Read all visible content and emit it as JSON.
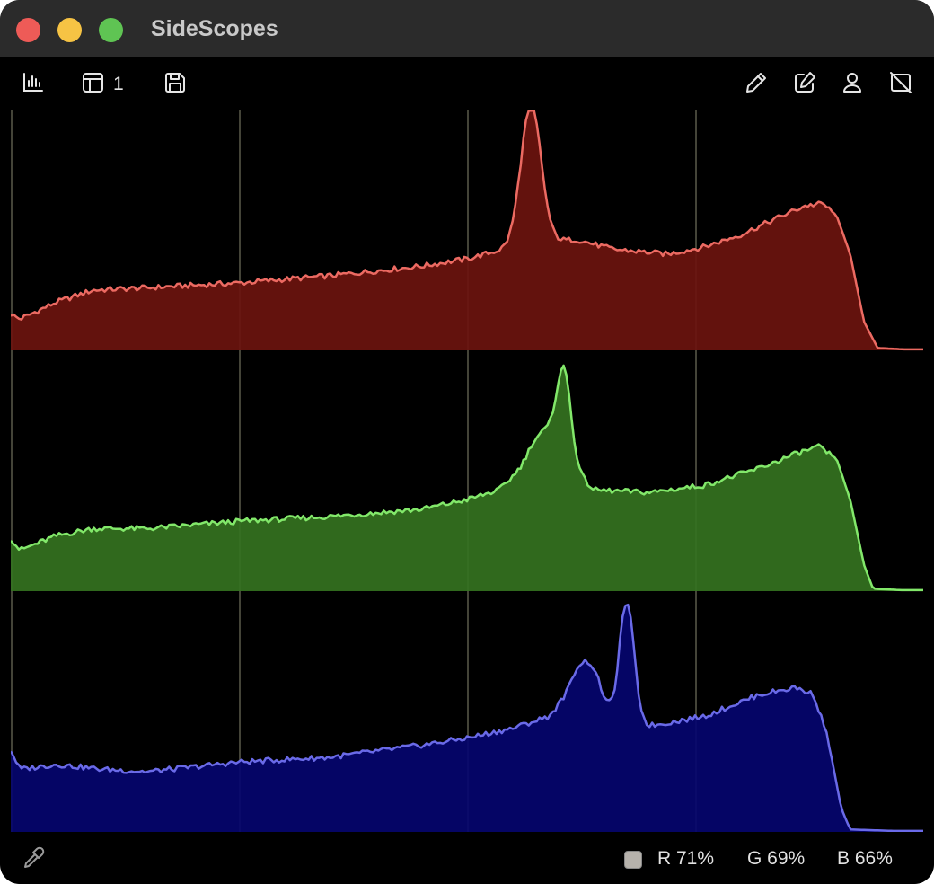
{
  "window": {
    "title": "SideScopes"
  },
  "toolbar": {
    "left_icons": [
      "histogram-icon",
      "layout-icon",
      "save-icon"
    ],
    "layout_number": "1",
    "right_icons": [
      "pencil-icon",
      "edit-note-icon",
      "person-icon",
      "no-display-icon"
    ]
  },
  "scope": {
    "type": "rgb-parade-histogram",
    "vertical_guides": 3,
    "channels": [
      {
        "name": "red",
        "fill": "#6b140e",
        "stroke": "#ec6a62"
      },
      {
        "name": "green",
        "fill": "#34721f",
        "stroke": "#82e86a"
      },
      {
        "name": "blue",
        "fill": "#05056e",
        "stroke": "#6a6ae8"
      }
    ]
  },
  "footer": {
    "swatch_color": "#b6b2ac",
    "r_label": "R 71%",
    "g_label": "G 69%",
    "b_label": "B 66%"
  },
  "colors": {
    "titlebar": "#2b2b2b",
    "background": "#000000",
    "guide": "#5a5a4a"
  }
}
